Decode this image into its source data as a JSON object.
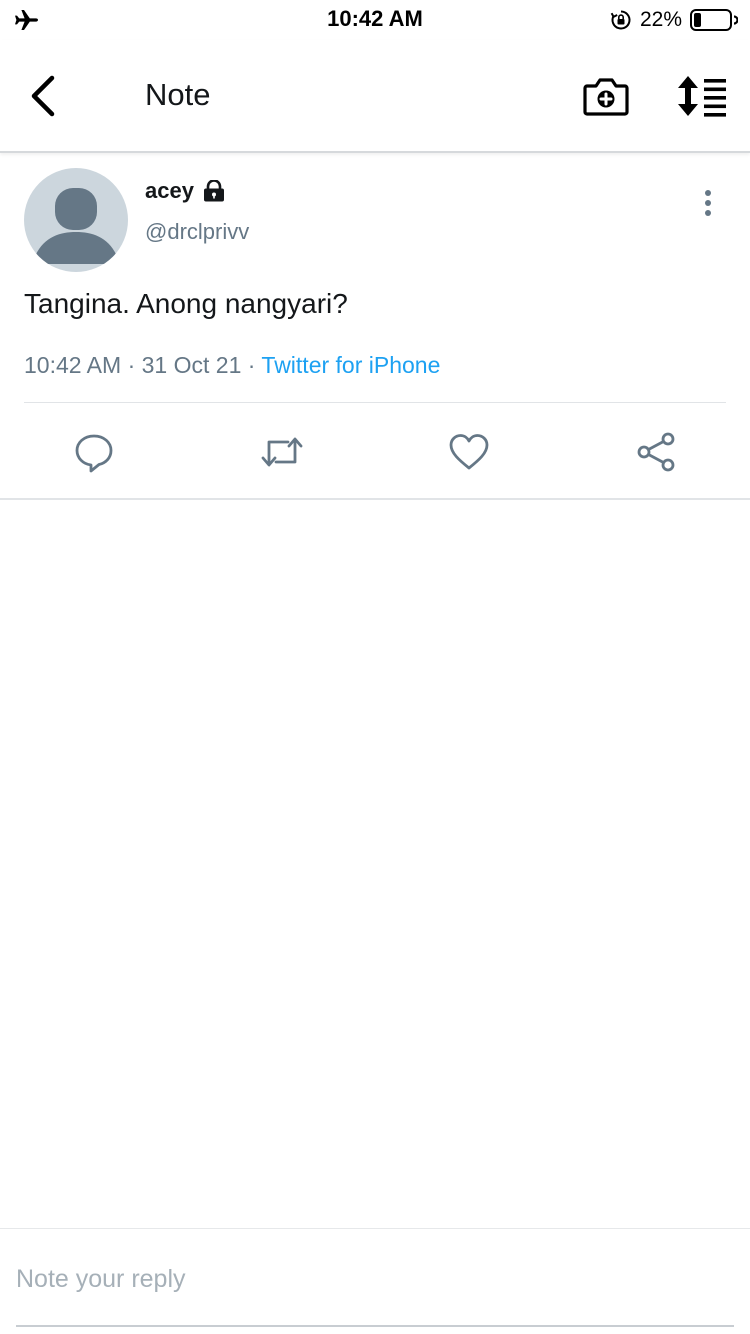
{
  "status_bar": {
    "time": "10:42 AM",
    "battery_percent": "22%",
    "battery_level": 0.22,
    "icons": [
      "airplane-mode-icon",
      "orientation-lock-icon",
      "battery-icon"
    ]
  },
  "nav": {
    "title": "Note",
    "icons": [
      "back-chevron-icon",
      "camera-plus-icon",
      "sort-icon"
    ]
  },
  "tweet": {
    "display_name": "acey",
    "handle": "@drclprivv",
    "text": "Tangina. Anong nangyari?",
    "time": "10:42 AM",
    "date": "31 Oct 21",
    "separator": "·",
    "source": "Twitter for iPhone",
    "icons": [
      "lock-icon",
      "more-vertical-icon"
    ],
    "actions": [
      {
        "name": "reply",
        "icon": "reply-icon"
      },
      {
        "name": "retweet",
        "icon": "retweet-icon"
      },
      {
        "name": "like",
        "icon": "heart-icon"
      },
      {
        "name": "share",
        "icon": "share-icon"
      }
    ]
  },
  "reply": {
    "placeholder": "Note your reply",
    "value": ""
  },
  "colors": {
    "accent": "#1da1f2",
    "text_primary": "#14171a",
    "text_secondary": "#657786",
    "avatar_bg": "#ccd6dd",
    "avatar_fg": "#657786"
  }
}
